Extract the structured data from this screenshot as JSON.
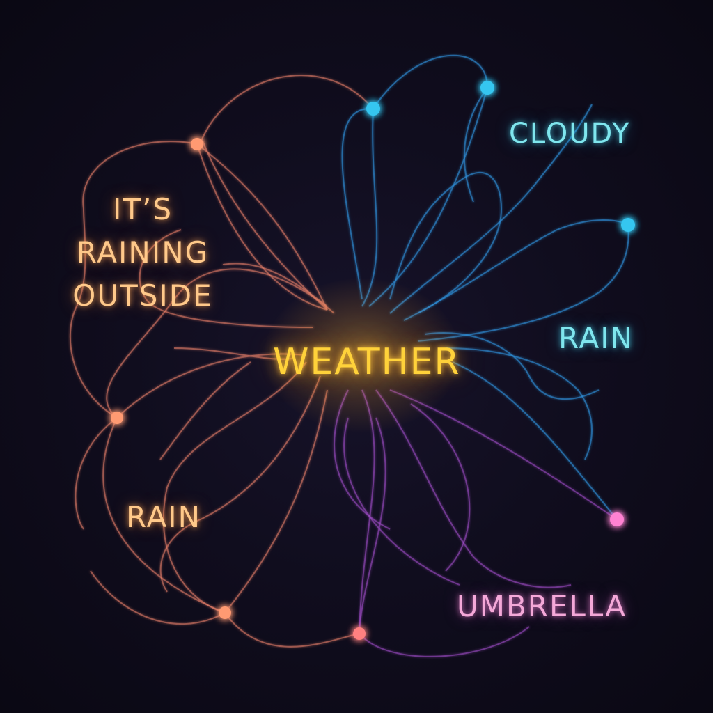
{
  "diagram": {
    "center": "WEATHER",
    "outside_lines": [
      "IT’S",
      "RAINING",
      "OUTSIDE"
    ],
    "rain_left": "RAIN",
    "cloudy": "CLOUDY",
    "rain_right": "RAIN",
    "umbrella": "UMBRELLA"
  },
  "colors": {
    "background": "#0c0a16",
    "center": "#ffd23a",
    "warm": "#ffc98a",
    "warm_node": "#ff8f6a",
    "cool": "#7fe6ee",
    "cool_node": "#33c4ee",
    "pink": "#f4a8d8",
    "pink_node": "#ff7fd0"
  }
}
